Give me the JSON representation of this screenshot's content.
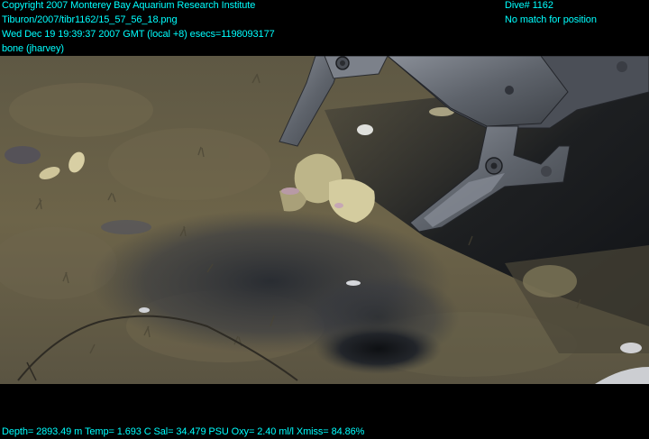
{
  "overlay": {
    "copyright": "Copyright 2007 Monterey Bay Aquarium Research Institute",
    "filepath": "Tiburon/2007/tibr1162/15_57_56_18.png",
    "timestamp": "Wed Dec 19 19:39:37 2007 GMT (local +8)  esecs=1198093177",
    "annotator": "bone (jharvey)",
    "dive": "Dive# 1162",
    "position_status": "No match for position",
    "telemetry": "Depth= 2893.49 m  Temp= 1.693 C  Sal= 34.479 PSU  Oxy= 2.40 ml/l  Xmiss= 84.86%"
  },
  "colors": {
    "overlay_text": "#00ffff",
    "background": "#000000",
    "sediment": "#6b6148",
    "dark_sediment": "#2e3138",
    "manipulator": "#6a6f78",
    "whale_bone_debris": "#c9c19a"
  }
}
